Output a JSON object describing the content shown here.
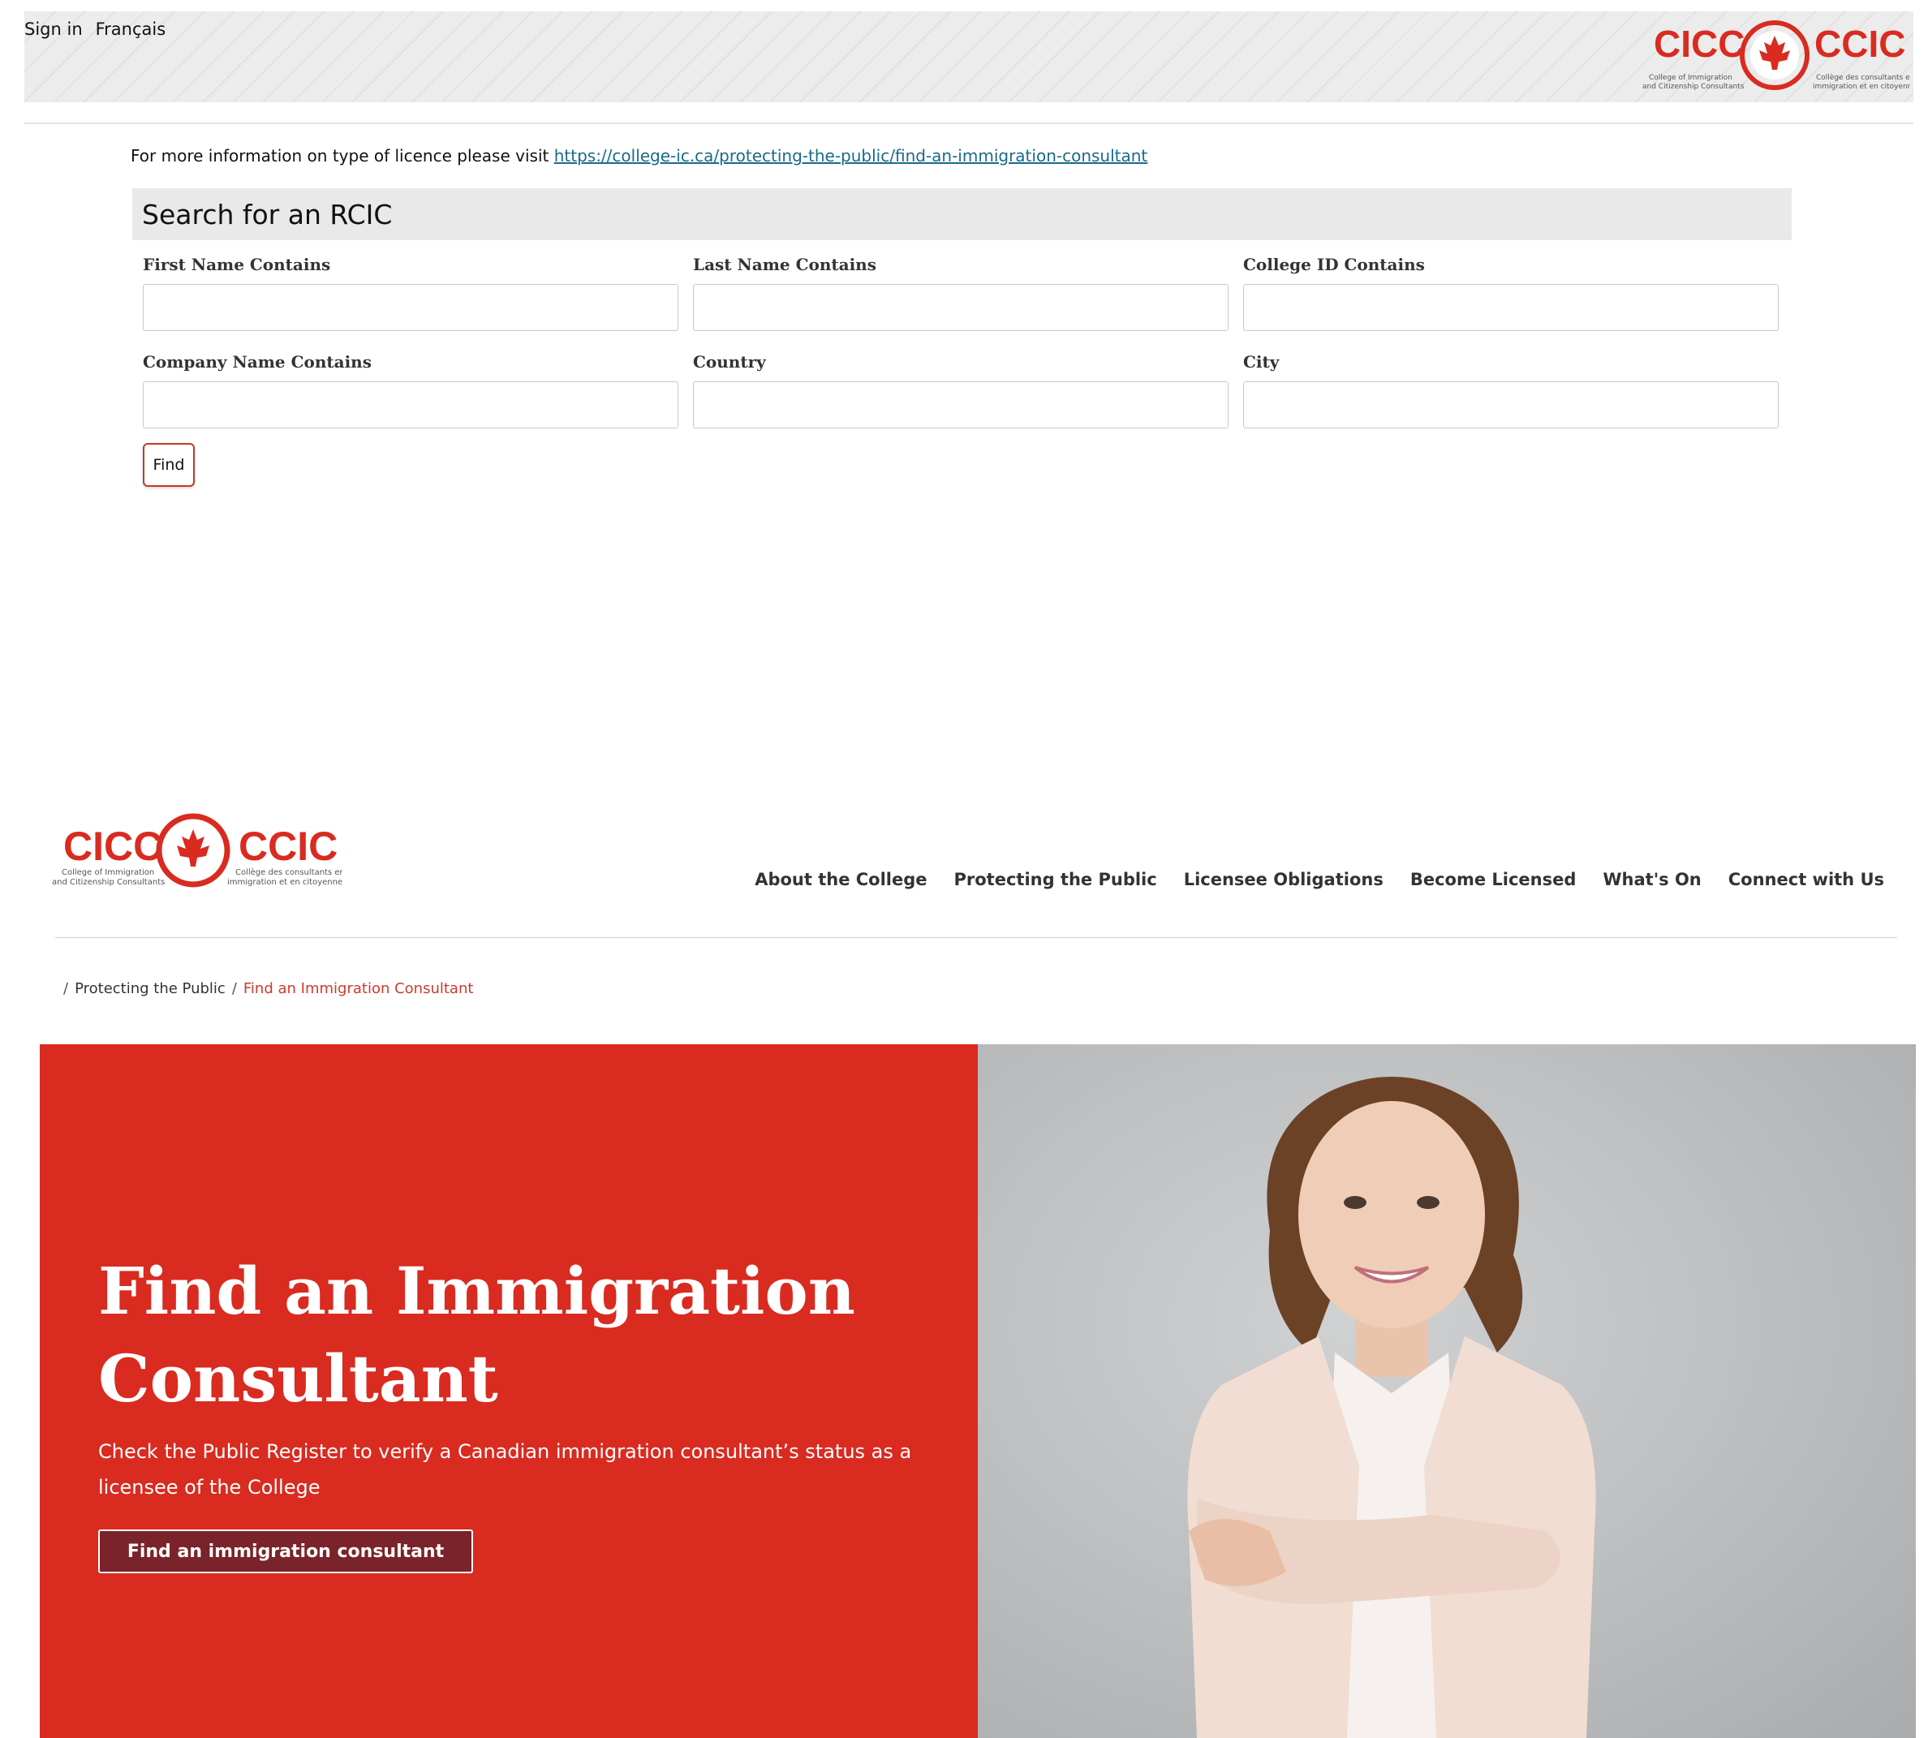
{
  "top_bar": {
    "sign_in": "Sign in",
    "language": "Français"
  },
  "logo": {
    "left_word": "CICC",
    "right_word": "CCIC",
    "left_sub_1": "College of Immigration",
    "left_sub_2": "and Citizenship Consultants",
    "right_sub_1": "Collège des consultants en",
    "right_sub_2": "immigration et en citoyenneté"
  },
  "info": {
    "text": "For more information on type of licence please visit ",
    "link": "https://college-ic.ca/protecting-the-public/find-an-immigration-consultant"
  },
  "search": {
    "title": "Search for an RCIC",
    "fields": [
      {
        "label": "First Name Contains",
        "value": ""
      },
      {
        "label": "Last Name Contains",
        "value": ""
      },
      {
        "label": "College ID Contains",
        "value": ""
      },
      {
        "label": "Company Name Contains",
        "value": ""
      },
      {
        "label": "Country",
        "value": ""
      },
      {
        "label": "City",
        "value": ""
      }
    ],
    "find_label": "Find"
  },
  "nav": {
    "items": [
      "About the College",
      "Protecting the Public",
      "Licensee Obligations",
      "Become Licensed",
      "What's On",
      "Connect with Us"
    ]
  },
  "breadcrumb": {
    "separator": "/",
    "parent": "Protecting the Public",
    "current": "Find an Immigration Consultant"
  },
  "hero": {
    "title": "Find an Immigration Consultant",
    "subtitle": "Check the Public Register to verify a Canadian immigration consultant’s status as a licensee of the College",
    "cta": "Find an immigration consultant"
  },
  "colors": {
    "brand_red": "#d92b20",
    "button_maroon": "#7a232b",
    "link_blue": "#1a6a8a",
    "breadcrumb_current": "#d0392b"
  }
}
